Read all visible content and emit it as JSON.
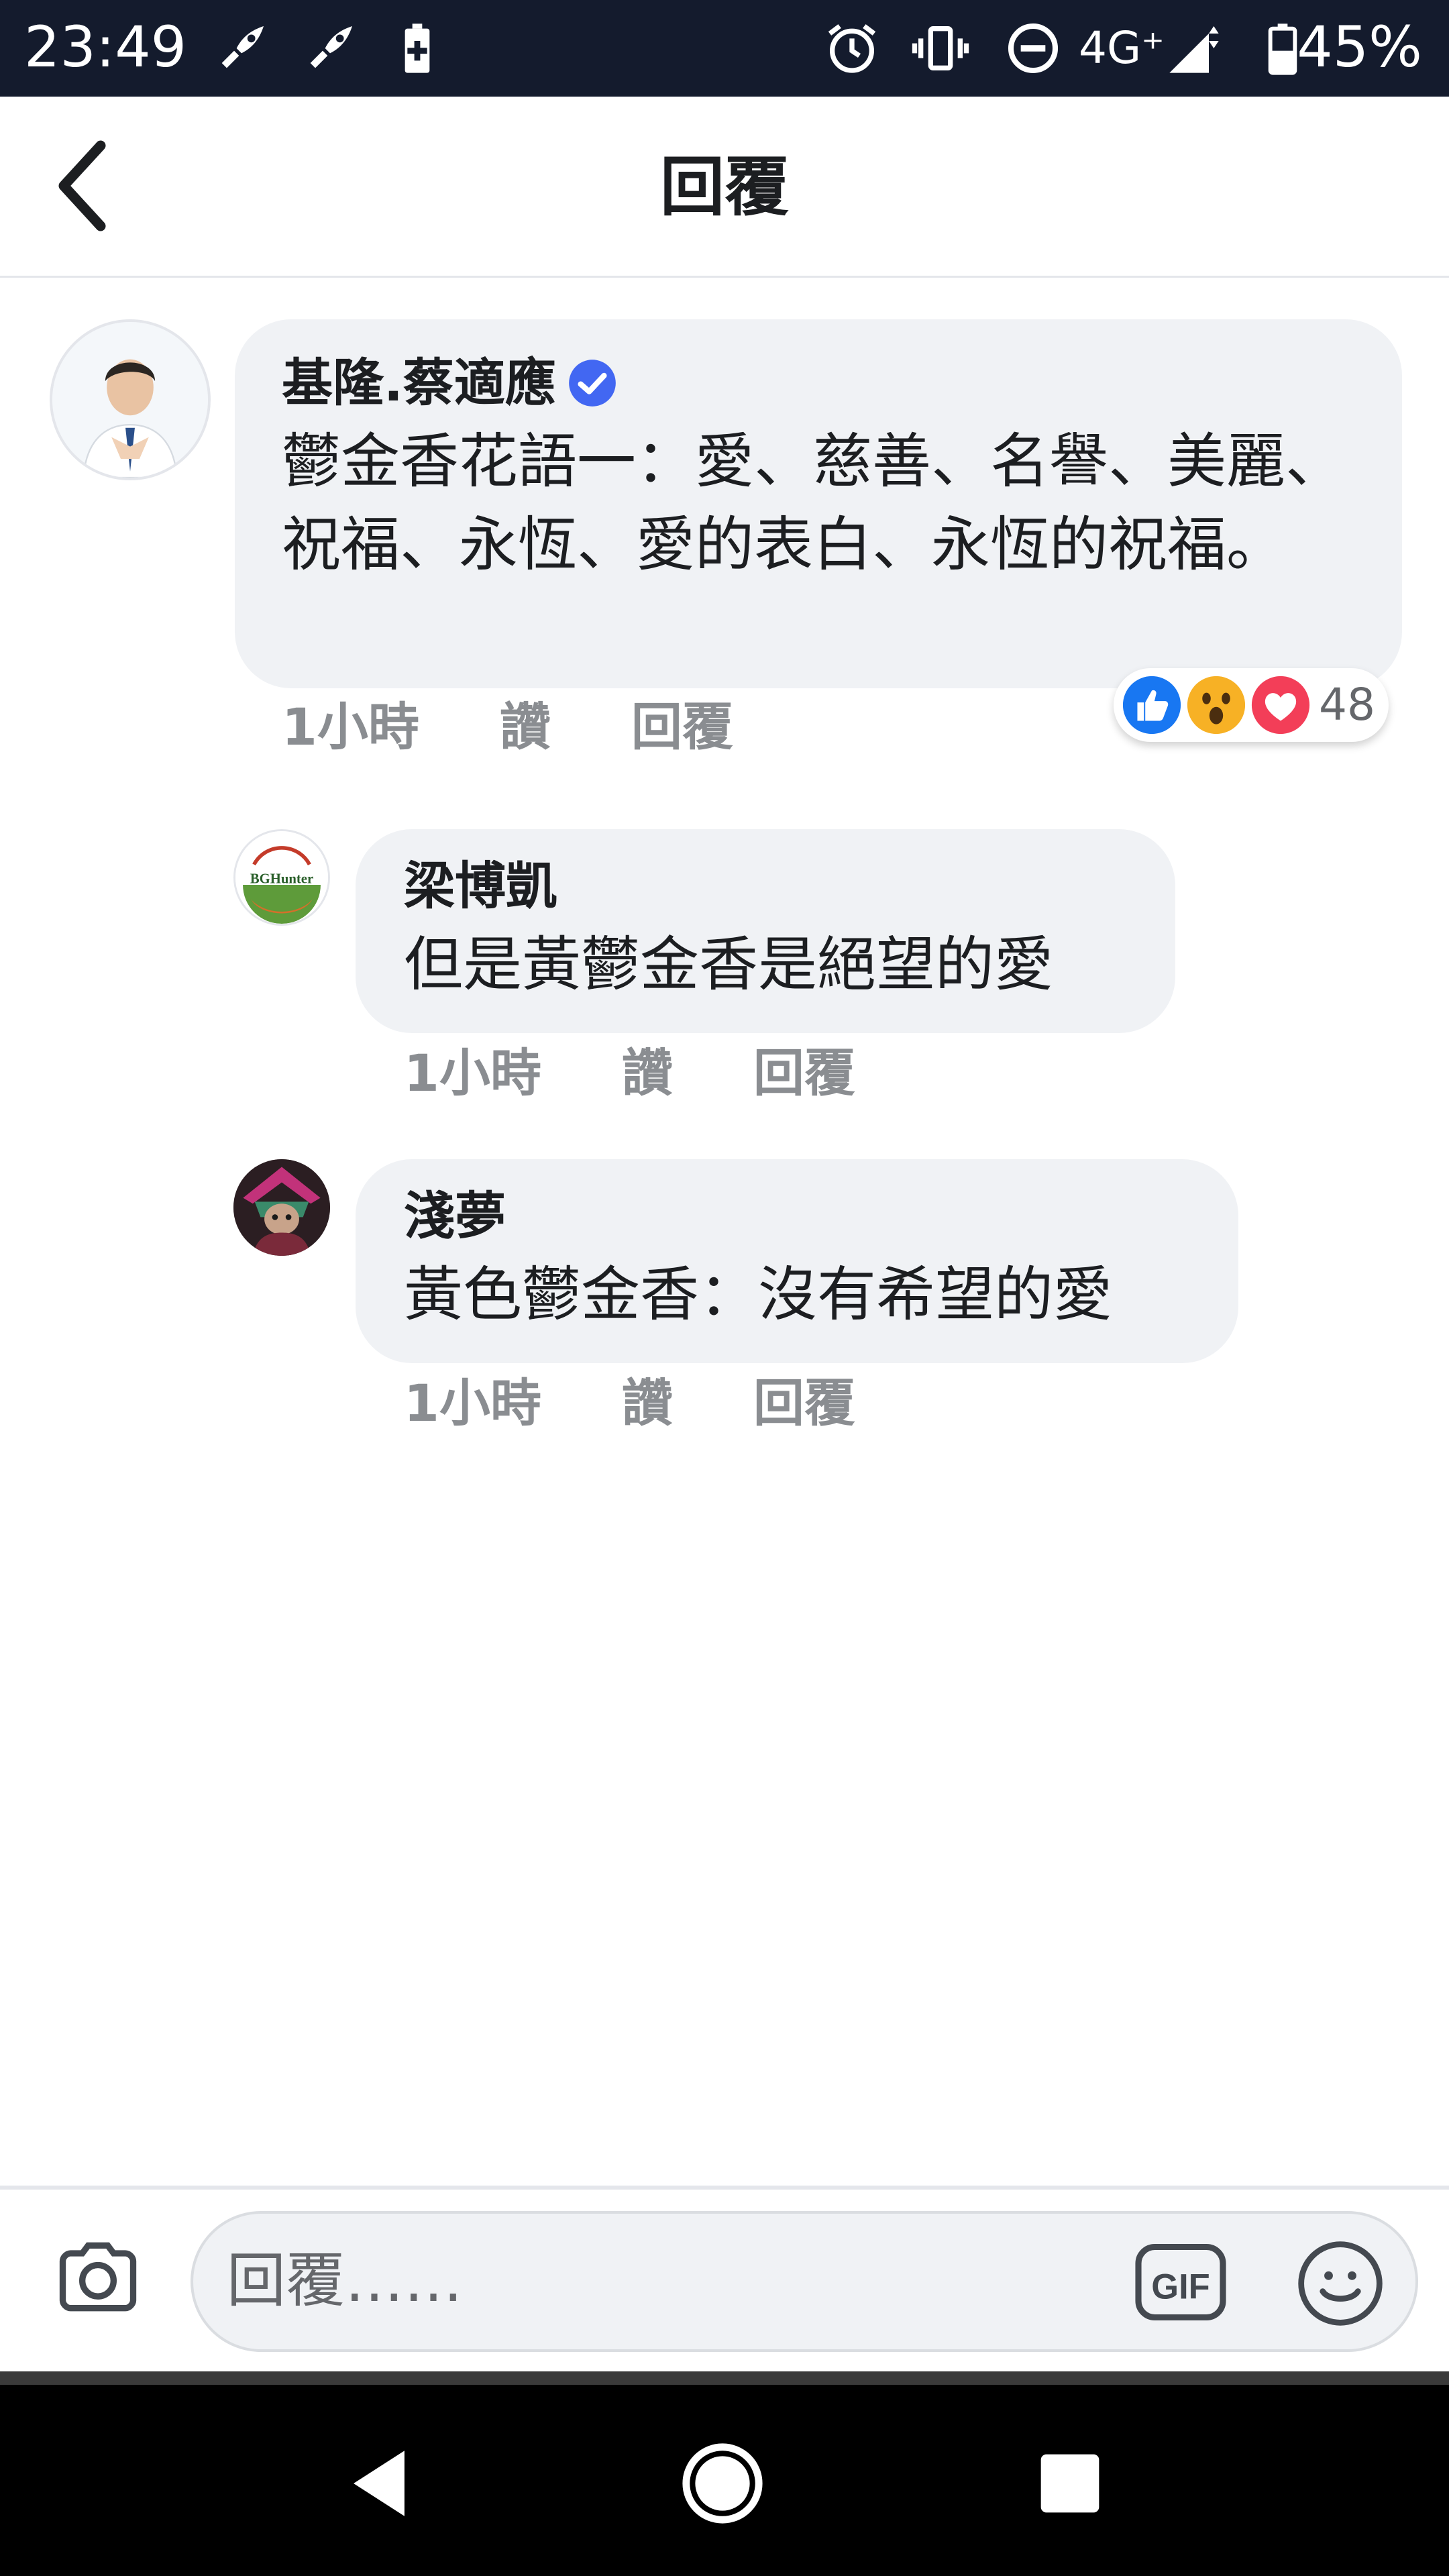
{
  "status_bar": {
    "time": "23:49",
    "network": "4G⁺",
    "battery": "45%",
    "icons": [
      "rocket-icon",
      "rocket-icon",
      "battery-saver-icon",
      "alarm-icon",
      "vibrate-icon",
      "do-not-disturb-icon",
      "signal-icon",
      "battery-icon"
    ]
  },
  "header": {
    "title": "回覆",
    "back_icon": "chevron-left-icon"
  },
  "comments": [
    {
      "author": "基隆.蔡適應",
      "verified": true,
      "text": "鬱金香花語一：愛、慈善、名譽、美麗、祝福、永恆、愛的表白、永恆的祝福。",
      "time": "1小時",
      "like_label": "讚",
      "reply_label": "回覆",
      "reactions": {
        "icons": [
          "like-icon",
          "wow-icon",
          "love-icon"
        ],
        "count": "48"
      }
    },
    {
      "author": "梁博凱",
      "avatar_text": "BGHunter",
      "text": "但是黃鬱金香是絕望的愛",
      "time": "1小時",
      "like_label": "讚",
      "reply_label": "回覆"
    },
    {
      "author": "淺夢",
      "text": "黃色鬱金香：沒有希望的愛",
      "time": "1小時",
      "like_label": "讚",
      "reply_label": "回覆"
    }
  ],
  "composer": {
    "placeholder": "回覆……",
    "gif_label": "GIF"
  },
  "colors": {
    "status_bar_bg": "#141b2d",
    "bubble_bg": "#f0f2f5",
    "verified_blue": "#4267f2",
    "like_blue": "#1877f2",
    "love_red": "#f33e58",
    "wow_yellow": "#f7b125"
  }
}
